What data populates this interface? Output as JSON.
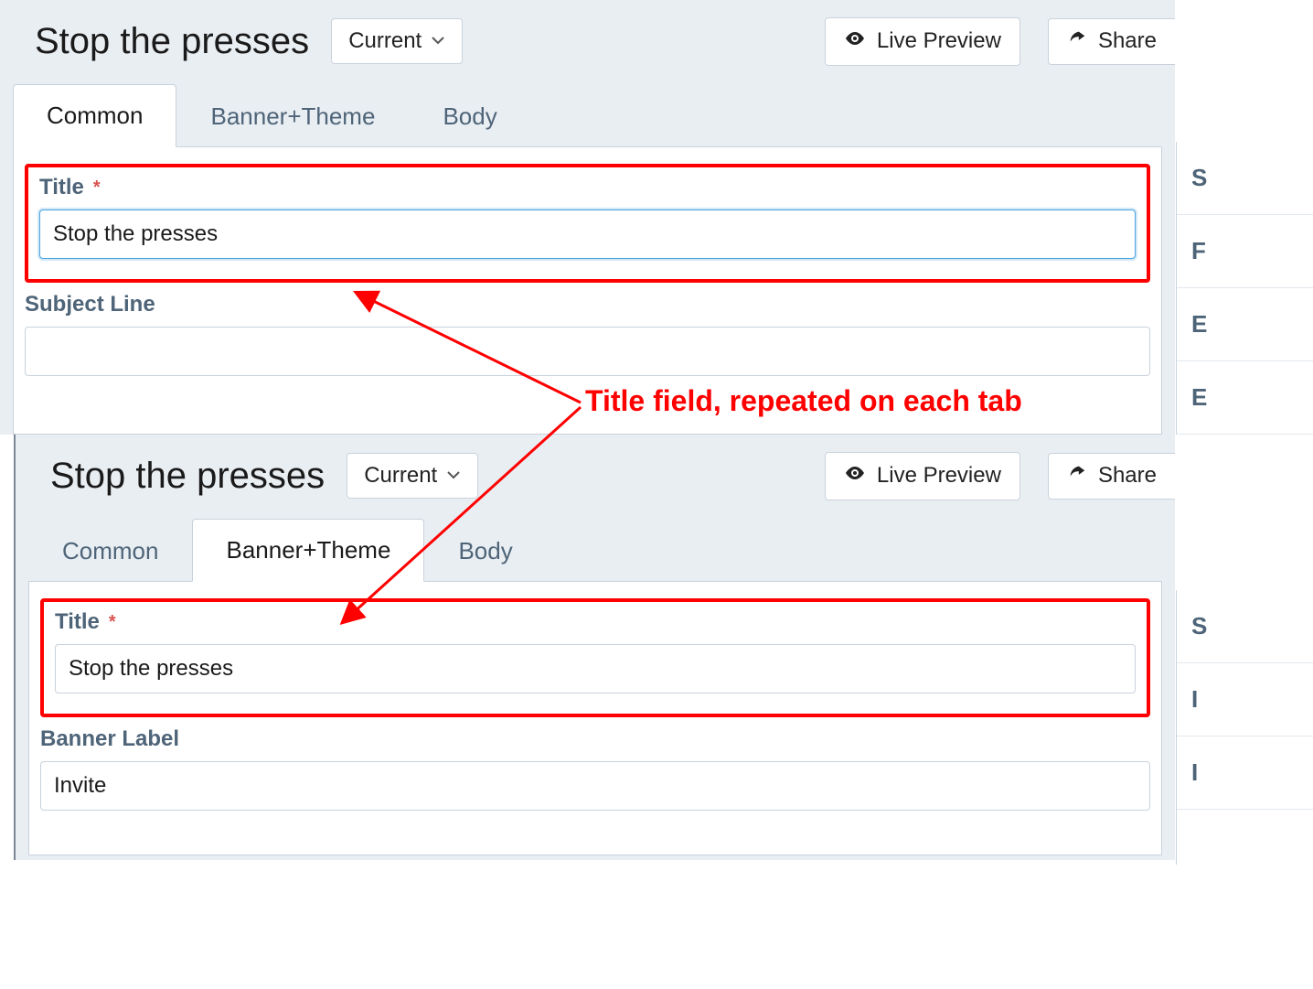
{
  "annotation": "Title field, repeated on each tab",
  "panels": {
    "top": {
      "page_title": "Stop the presses",
      "dropdown_label": "Current",
      "actions": {
        "preview": "Live Preview",
        "share": "Share"
      },
      "tabs": {
        "common": "Common",
        "banner": "Banner+Theme",
        "body": "Body",
        "active": "common"
      },
      "fields": {
        "title_label": "Title",
        "title_value": "Stop the presses",
        "subject_label": "Subject Line",
        "subject_value": ""
      },
      "sidebar_letters": [
        "S",
        "F",
        "E",
        "E"
      ]
    },
    "bottom": {
      "page_title": "Stop the presses",
      "dropdown_label": "Current",
      "actions": {
        "preview": "Live Preview",
        "share": "Share"
      },
      "tabs": {
        "common": "Common",
        "banner": "Banner+Theme",
        "body": "Body",
        "active": "banner"
      },
      "fields": {
        "title_label": "Title",
        "title_value": "Stop the presses",
        "banner_label_label": "Banner Label",
        "banner_label_value": "Invite"
      },
      "sidebar_letters": [
        "S",
        "I",
        "I"
      ]
    }
  }
}
